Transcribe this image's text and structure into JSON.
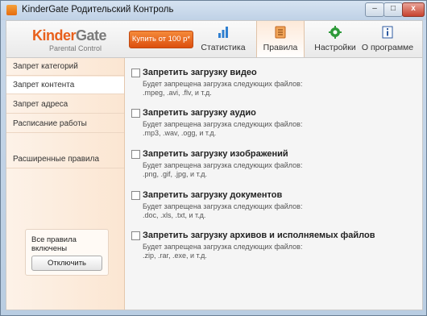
{
  "window": {
    "title": "KinderGate Родительский Контроль",
    "min": "–",
    "max": "□",
    "close": "x"
  },
  "header": {
    "logo_kinder": "Kinder",
    "logo_gate": "Gate",
    "logo_sub": "Parental Control",
    "buy_label": "Купить от 100 р*",
    "tabs": [
      {
        "label": "Статистика",
        "icon": "bar-chart-icon"
      },
      {
        "label": "Правила",
        "icon": "rules-document-icon",
        "active": true
      },
      {
        "label": "Настройки",
        "icon": "settings-gear-icon"
      },
      {
        "label": "О программе",
        "icon": "info-icon"
      }
    ]
  },
  "sidebar": {
    "items": [
      {
        "label": "Запрет категорий"
      },
      {
        "label": "Запрет контента",
        "active": true
      },
      {
        "label": "Запрет адреса"
      },
      {
        "label": "Расписание работы"
      },
      {
        "label": "Расширенные правила"
      }
    ],
    "rules_status": "Все правила включены",
    "disable_label": "Отключить"
  },
  "main": {
    "rules": [
      {
        "title": "Запретить загрузку видео",
        "desc": "Будет запрещена загрузка следующих файлов:",
        "ext": ".mpeg, .avi, .flv, и т.д.",
        "checked": false
      },
      {
        "title": "Запретить загрузку аудио",
        "desc": "Будет запрещена загрузка следующих файлов:",
        "ext": ".mp3, .wav, .ogg, и т.д.",
        "checked": false
      },
      {
        "title": "Запретить загрузку изображений",
        "desc": "Будет запрещена загрузка следующих файлов:",
        "ext": ".png, .gif, .jpg, и т.д.",
        "checked": false
      },
      {
        "title": "Запретить загрузку документов",
        "desc": "Будет запрещена загрузка следующих файлов:",
        "ext": ".doc, .xls, .txt, и т.д.",
        "checked": false
      },
      {
        "title": "Запретить загрузку архивов и исполняемых файлов",
        "desc": "Будет запрещена загрузка следующих файлов:",
        "ext": ".zip, .rar, .exe, и т.д.",
        "checked": false
      }
    ]
  },
  "colors": {
    "accent": "#e8601c",
    "sidebar_bg": "#fbe6d2",
    "main_bg": "#f5f5f5"
  }
}
